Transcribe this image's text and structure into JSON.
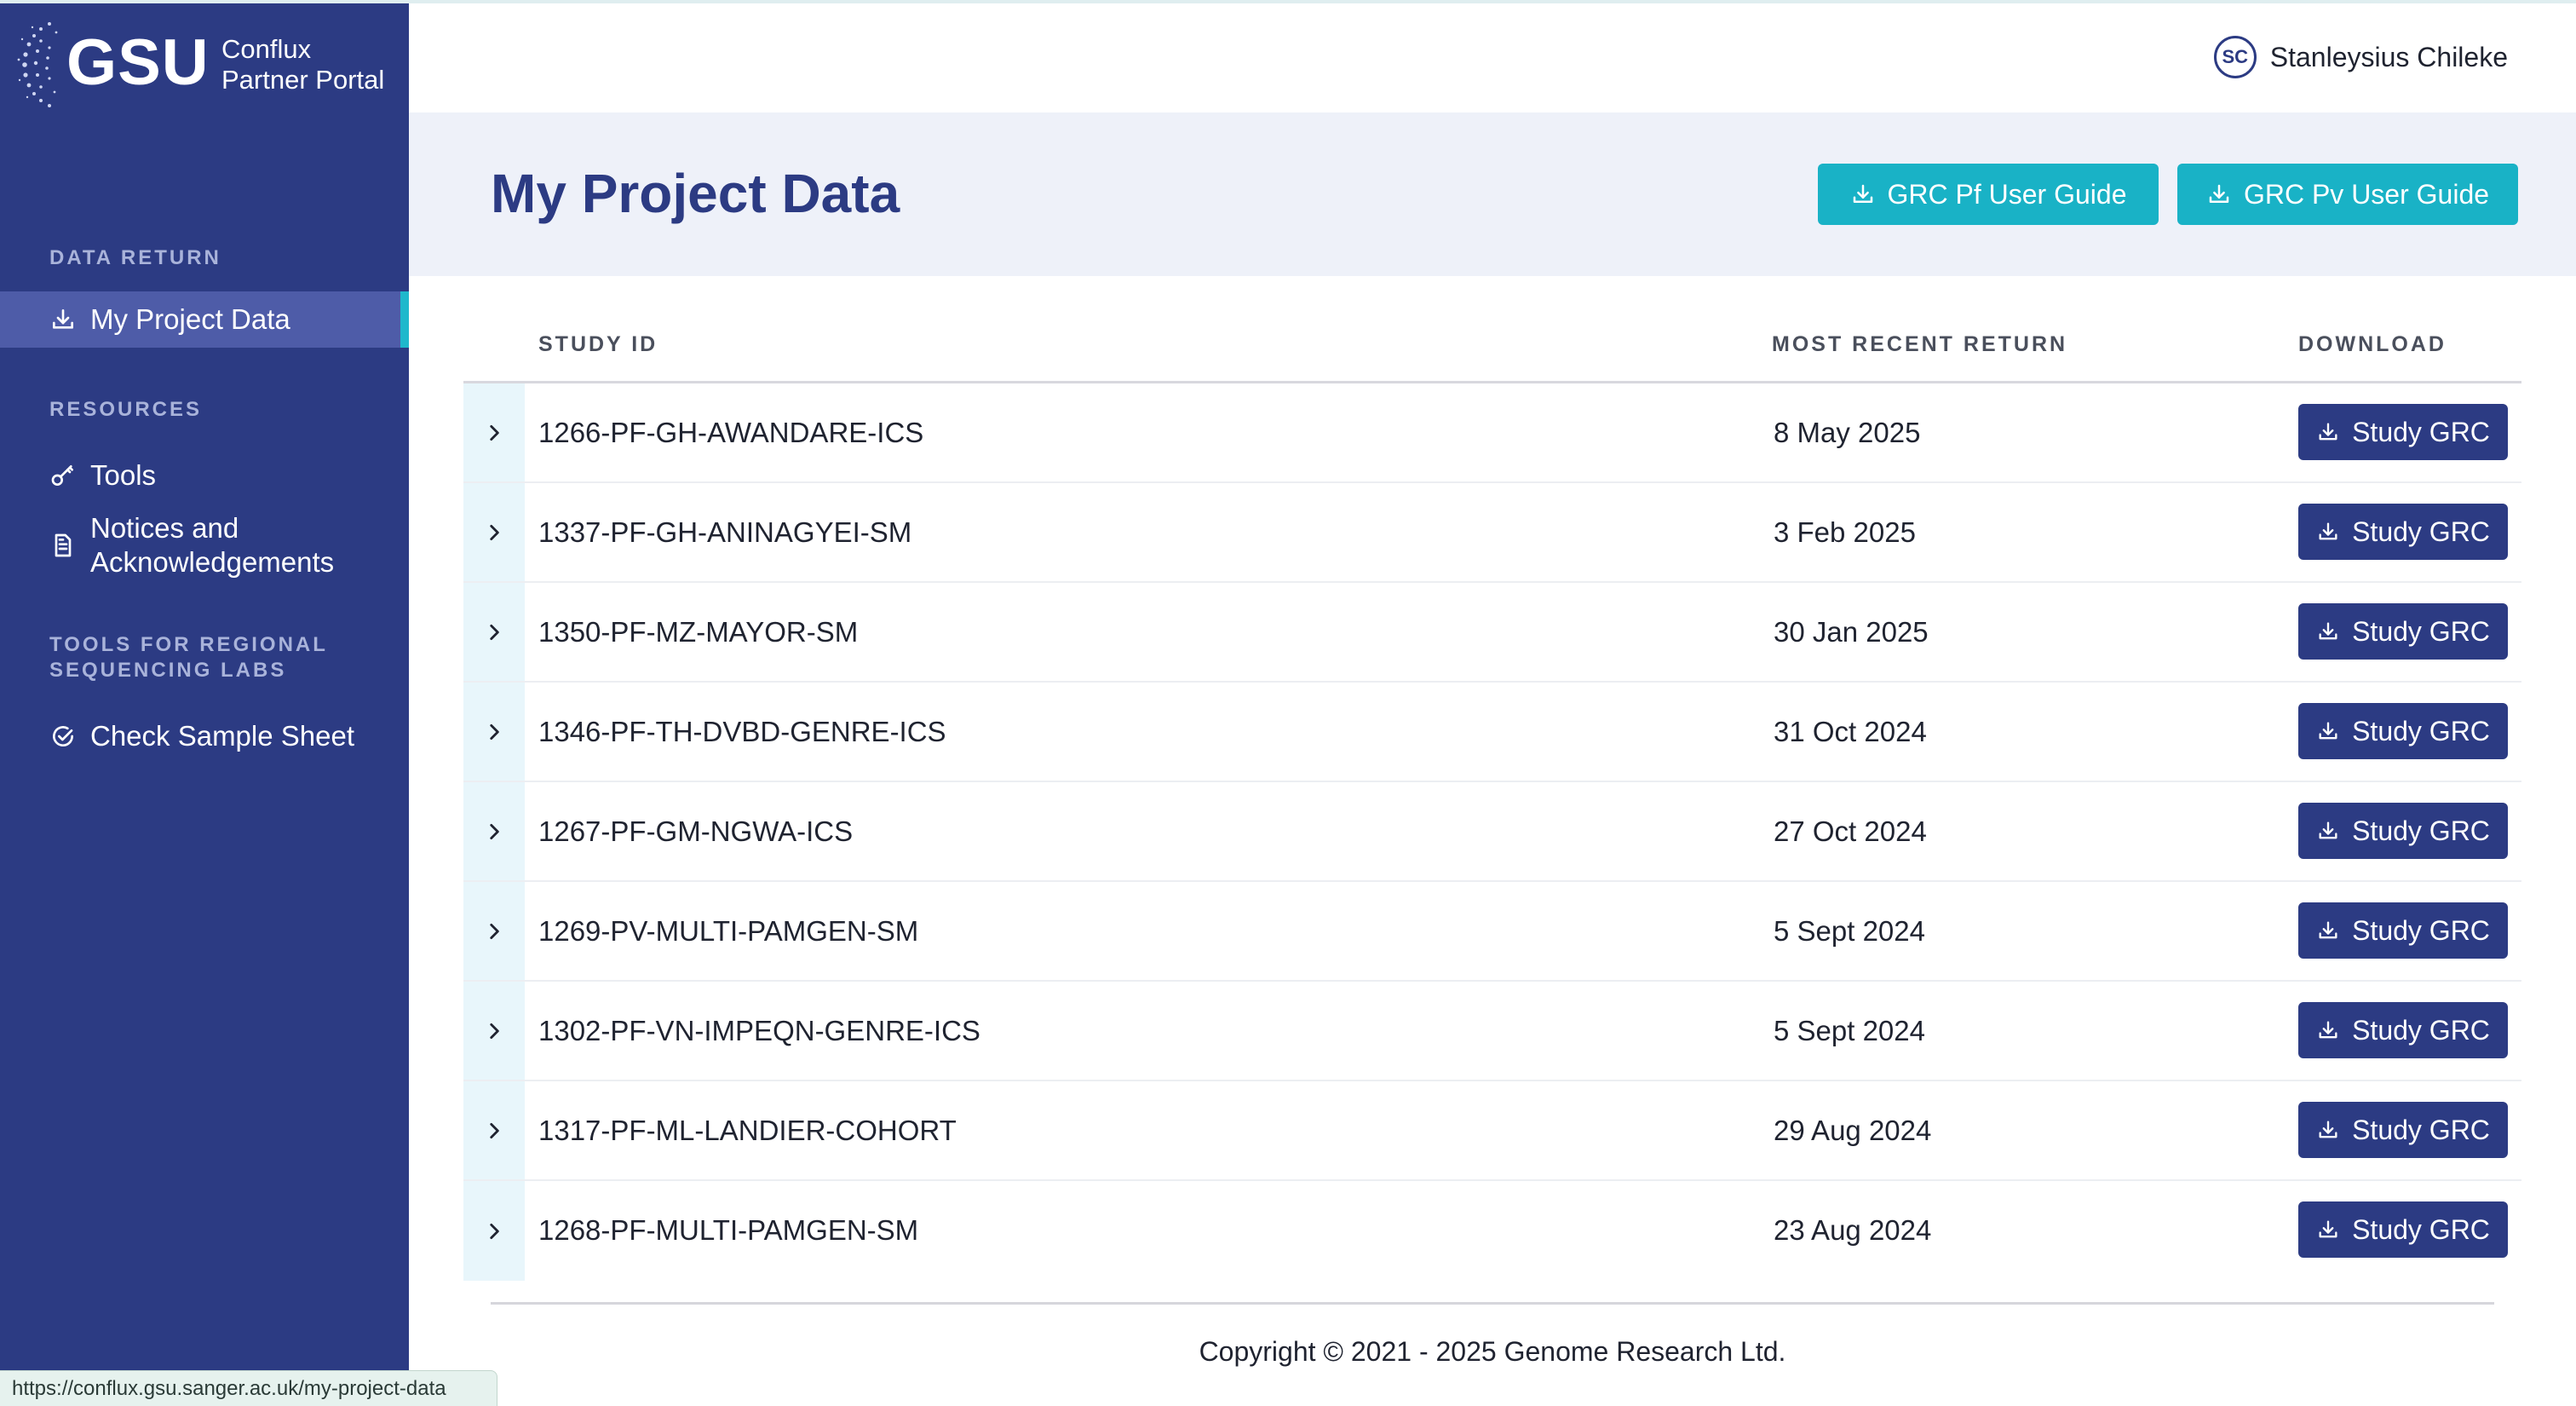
{
  "brand": {
    "logo_text": "GSU",
    "subtitle_line1": "Conflux",
    "subtitle_line2": "Partner Portal"
  },
  "sidebar": {
    "sections": [
      {
        "label": "DATA RETURN"
      },
      {
        "label": "RESOURCES"
      },
      {
        "label": "TOOLS FOR REGIONAL SEQUENCING LABS"
      }
    ],
    "items": [
      {
        "label": "My Project Data",
        "icon": "download-icon",
        "active": true
      },
      {
        "label": "Tools",
        "icon": "key-icon"
      },
      {
        "label": "Notices and Acknowledgements",
        "icon": "document-icon"
      },
      {
        "label": "Check Sample Sheet",
        "icon": "check-circle-icon"
      }
    ]
  },
  "user": {
    "initials": "SC",
    "name": "Stanleysius Chileke"
  },
  "page": {
    "title": "My Project Data",
    "guide_pf_label": "GRC Pf User Guide",
    "guide_pv_label": "GRC Pv User Guide"
  },
  "table": {
    "headers": {
      "study_id": "STUDY ID",
      "recent": "MOST RECENT RETURN",
      "download": "DOWNLOAD"
    },
    "rows": [
      {
        "study_id": "1266-PF-GH-AWANDARE-ICS",
        "recent": "8 May 2025",
        "button": "Study GRC"
      },
      {
        "study_id": "1337-PF-GH-ANINAGYEI-SM",
        "recent": "3 Feb 2025",
        "button": "Study GRC"
      },
      {
        "study_id": "1350-PF-MZ-MAYOR-SM",
        "recent": "30 Jan 2025",
        "button": "Study GRC"
      },
      {
        "study_id": "1346-PF-TH-DVBD-GENRE-ICS",
        "recent": "31 Oct 2024",
        "button": "Study GRC"
      },
      {
        "study_id": "1267-PF-GM-NGWA-ICS",
        "recent": "27 Oct 2024",
        "button": "Study GRC"
      },
      {
        "study_id": "1269-PV-MULTI-PAMGEN-SM",
        "recent": "5 Sept 2024",
        "button": "Study GRC"
      },
      {
        "study_id": "1302-PF-VN-IMPEQN-GENRE-ICS",
        "recent": "5 Sept 2024",
        "button": "Study GRC"
      },
      {
        "study_id": "1317-PF-ML-LANDIER-COHORT",
        "recent": "29 Aug 2024",
        "button": "Study GRC"
      },
      {
        "study_id": "1268-PF-MULTI-PAMGEN-SM",
        "recent": "23 Aug 2024",
        "button": "Study GRC"
      }
    ]
  },
  "footer": {
    "copyright": "Copyright © 2021 - 2025 Genome Research Ltd."
  },
  "status_bar": {
    "url": "https://conflux.gsu.sanger.ac.uk/my-project-data"
  },
  "colors": {
    "sidebar": "#2c3b83",
    "accent": "#19b2c6",
    "primary_button": "#2c3b83",
    "header_band": "#eef1f9"
  }
}
